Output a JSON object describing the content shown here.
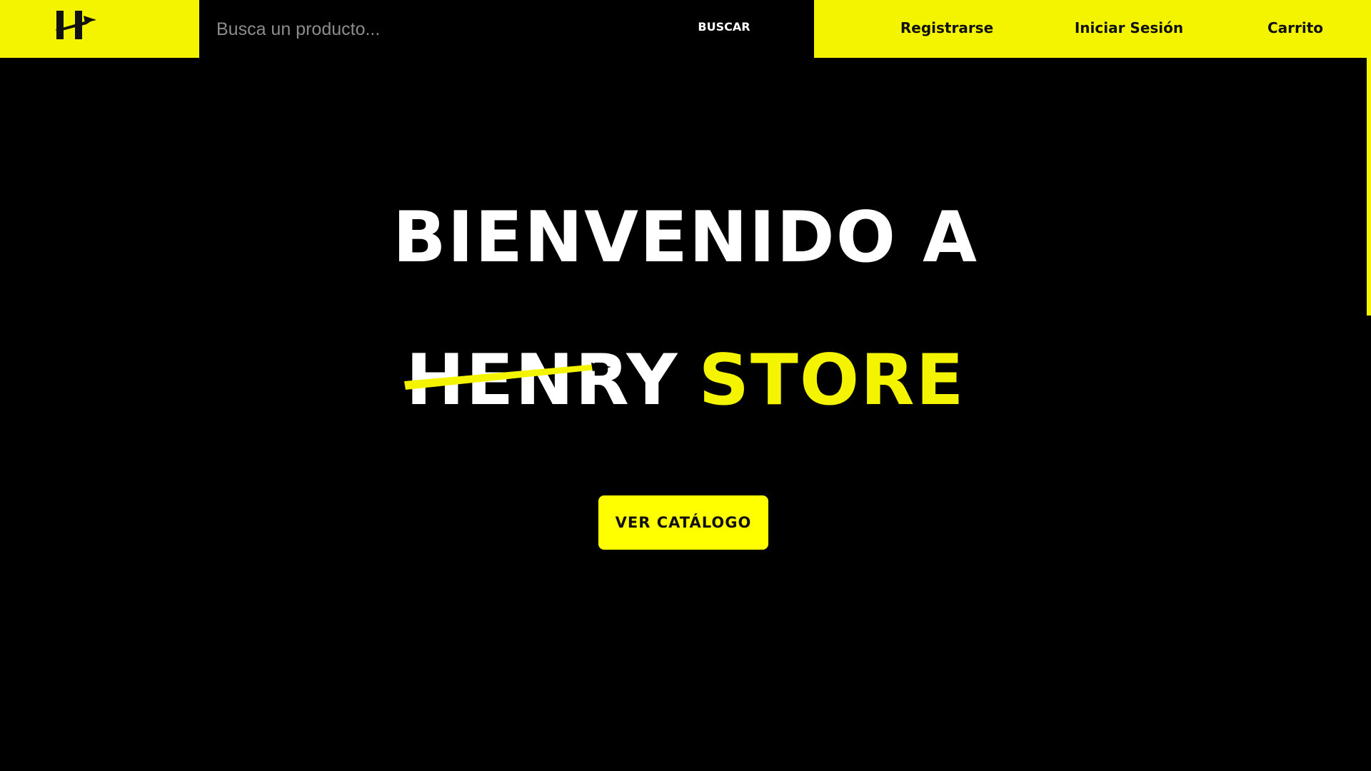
{
  "header": {
    "logo_name": "henry-logo",
    "search": {
      "placeholder": "Busca un producto...",
      "value": "",
      "button_label": "BUSCAR"
    },
    "nav": {
      "register_label": "Registrarse",
      "login_label": "Iniciar Sesión",
      "cart_label": "Carrito"
    }
  },
  "hero": {
    "title": "BIENVENIDO A",
    "brand_word": "HENRY",
    "store_word": "STORE",
    "cta_label": "VER CATÁLOGO"
  },
  "colors": {
    "accent": "#f4f400",
    "background": "#000000",
    "text": "#ffffff",
    "dark_text": "#111111"
  }
}
